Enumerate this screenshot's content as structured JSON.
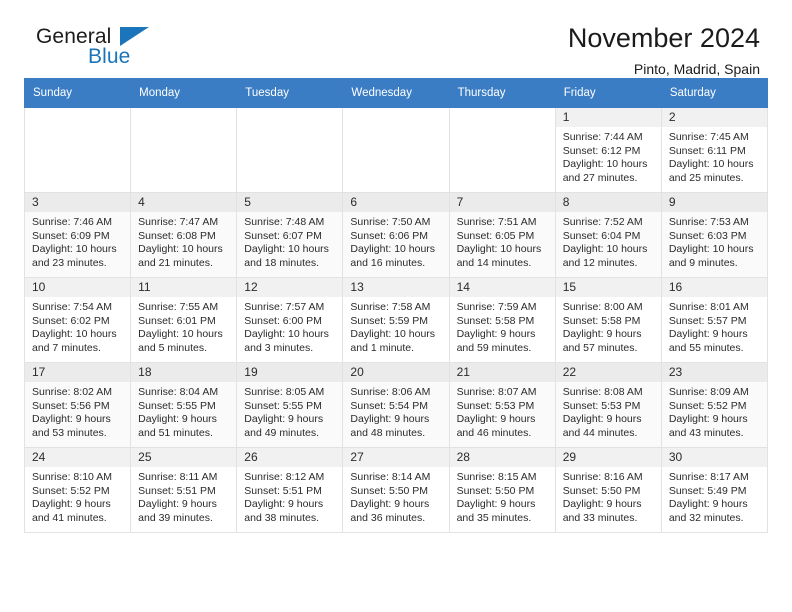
{
  "brand": {
    "name_part1": "General",
    "name_part2": "Blue",
    "logo_color": "#1b75bb"
  },
  "header": {
    "title": "November 2024",
    "location": "Pinto, Madrid, Spain"
  },
  "theme": {
    "header_row_bg": "#3b7dc4",
    "header_row_text": "#ffffff",
    "alt_row_bg": "#fafafa",
    "day_number_bg": "#f1f1f1"
  },
  "weekdays": [
    "Sunday",
    "Monday",
    "Tuesday",
    "Wednesday",
    "Thursday",
    "Friday",
    "Saturday"
  ],
  "labels": {
    "sunrise_prefix": "Sunrise:",
    "sunset_prefix": "Sunset:",
    "daylight_prefix": "Daylight:"
  },
  "weeks": [
    [
      {
        "empty": true
      },
      {
        "empty": true
      },
      {
        "empty": true
      },
      {
        "empty": true
      },
      {
        "empty": true
      },
      {
        "empty": false,
        "day": "1",
        "sunrise": "Sunrise: 7:44 AM",
        "sunset": "Sunset: 6:12 PM",
        "daylight_line1": "Daylight: 10 hours",
        "daylight_line2": "and 27 minutes."
      },
      {
        "empty": false,
        "day": "2",
        "sunrise": "Sunrise: 7:45 AM",
        "sunset": "Sunset: 6:11 PM",
        "daylight_line1": "Daylight: 10 hours",
        "daylight_line2": "and 25 minutes."
      }
    ],
    [
      {
        "empty": false,
        "day": "3",
        "sunrise": "Sunrise: 7:46 AM",
        "sunset": "Sunset: 6:09 PM",
        "daylight_line1": "Daylight: 10 hours",
        "daylight_line2": "and 23 minutes."
      },
      {
        "empty": false,
        "day": "4",
        "sunrise": "Sunrise: 7:47 AM",
        "sunset": "Sunset: 6:08 PM",
        "daylight_line1": "Daylight: 10 hours",
        "daylight_line2": "and 21 minutes."
      },
      {
        "empty": false,
        "day": "5",
        "sunrise": "Sunrise: 7:48 AM",
        "sunset": "Sunset: 6:07 PM",
        "daylight_line1": "Daylight: 10 hours",
        "daylight_line2": "and 18 minutes."
      },
      {
        "empty": false,
        "day": "6",
        "sunrise": "Sunrise: 7:50 AM",
        "sunset": "Sunset: 6:06 PM",
        "daylight_line1": "Daylight: 10 hours",
        "daylight_line2": "and 16 minutes."
      },
      {
        "empty": false,
        "day": "7",
        "sunrise": "Sunrise: 7:51 AM",
        "sunset": "Sunset: 6:05 PM",
        "daylight_line1": "Daylight: 10 hours",
        "daylight_line2": "and 14 minutes."
      },
      {
        "empty": false,
        "day": "8",
        "sunrise": "Sunrise: 7:52 AM",
        "sunset": "Sunset: 6:04 PM",
        "daylight_line1": "Daylight: 10 hours",
        "daylight_line2": "and 12 minutes."
      },
      {
        "empty": false,
        "day": "9",
        "sunrise": "Sunrise: 7:53 AM",
        "sunset": "Sunset: 6:03 PM",
        "daylight_line1": "Daylight: 10 hours",
        "daylight_line2": "and 9 minutes."
      }
    ],
    [
      {
        "empty": false,
        "day": "10",
        "sunrise": "Sunrise: 7:54 AM",
        "sunset": "Sunset: 6:02 PM",
        "daylight_line1": "Daylight: 10 hours",
        "daylight_line2": "and 7 minutes."
      },
      {
        "empty": false,
        "day": "11",
        "sunrise": "Sunrise: 7:55 AM",
        "sunset": "Sunset: 6:01 PM",
        "daylight_line1": "Daylight: 10 hours",
        "daylight_line2": "and 5 minutes."
      },
      {
        "empty": false,
        "day": "12",
        "sunrise": "Sunrise: 7:57 AM",
        "sunset": "Sunset: 6:00 PM",
        "daylight_line1": "Daylight: 10 hours",
        "daylight_line2": "and 3 minutes."
      },
      {
        "empty": false,
        "day": "13",
        "sunrise": "Sunrise: 7:58 AM",
        "sunset": "Sunset: 5:59 PM",
        "daylight_line1": "Daylight: 10 hours",
        "daylight_line2": "and 1 minute."
      },
      {
        "empty": false,
        "day": "14",
        "sunrise": "Sunrise: 7:59 AM",
        "sunset": "Sunset: 5:58 PM",
        "daylight_line1": "Daylight: 9 hours",
        "daylight_line2": "and 59 minutes."
      },
      {
        "empty": false,
        "day": "15",
        "sunrise": "Sunrise: 8:00 AM",
        "sunset": "Sunset: 5:58 PM",
        "daylight_line1": "Daylight: 9 hours",
        "daylight_line2": "and 57 minutes."
      },
      {
        "empty": false,
        "day": "16",
        "sunrise": "Sunrise: 8:01 AM",
        "sunset": "Sunset: 5:57 PM",
        "daylight_line1": "Daylight: 9 hours",
        "daylight_line2": "and 55 minutes."
      }
    ],
    [
      {
        "empty": false,
        "day": "17",
        "sunrise": "Sunrise: 8:02 AM",
        "sunset": "Sunset: 5:56 PM",
        "daylight_line1": "Daylight: 9 hours",
        "daylight_line2": "and 53 minutes."
      },
      {
        "empty": false,
        "day": "18",
        "sunrise": "Sunrise: 8:04 AM",
        "sunset": "Sunset: 5:55 PM",
        "daylight_line1": "Daylight: 9 hours",
        "daylight_line2": "and 51 minutes."
      },
      {
        "empty": false,
        "day": "19",
        "sunrise": "Sunrise: 8:05 AM",
        "sunset": "Sunset: 5:55 PM",
        "daylight_line1": "Daylight: 9 hours",
        "daylight_line2": "and 49 minutes."
      },
      {
        "empty": false,
        "day": "20",
        "sunrise": "Sunrise: 8:06 AM",
        "sunset": "Sunset: 5:54 PM",
        "daylight_line1": "Daylight: 9 hours",
        "daylight_line2": "and 48 minutes."
      },
      {
        "empty": false,
        "day": "21",
        "sunrise": "Sunrise: 8:07 AM",
        "sunset": "Sunset: 5:53 PM",
        "daylight_line1": "Daylight: 9 hours",
        "daylight_line2": "and 46 minutes."
      },
      {
        "empty": false,
        "day": "22",
        "sunrise": "Sunrise: 8:08 AM",
        "sunset": "Sunset: 5:53 PM",
        "daylight_line1": "Daylight: 9 hours",
        "daylight_line2": "and 44 minutes."
      },
      {
        "empty": false,
        "day": "23",
        "sunrise": "Sunrise: 8:09 AM",
        "sunset": "Sunset: 5:52 PM",
        "daylight_line1": "Daylight: 9 hours",
        "daylight_line2": "and 43 minutes."
      }
    ],
    [
      {
        "empty": false,
        "day": "24",
        "sunrise": "Sunrise: 8:10 AM",
        "sunset": "Sunset: 5:52 PM",
        "daylight_line1": "Daylight: 9 hours",
        "daylight_line2": "and 41 minutes."
      },
      {
        "empty": false,
        "day": "25",
        "sunrise": "Sunrise: 8:11 AM",
        "sunset": "Sunset: 5:51 PM",
        "daylight_line1": "Daylight: 9 hours",
        "daylight_line2": "and 39 minutes."
      },
      {
        "empty": false,
        "day": "26",
        "sunrise": "Sunrise: 8:12 AM",
        "sunset": "Sunset: 5:51 PM",
        "daylight_line1": "Daylight: 9 hours",
        "daylight_line2": "and 38 minutes."
      },
      {
        "empty": false,
        "day": "27",
        "sunrise": "Sunrise: 8:14 AM",
        "sunset": "Sunset: 5:50 PM",
        "daylight_line1": "Daylight: 9 hours",
        "daylight_line2": "and 36 minutes."
      },
      {
        "empty": false,
        "day": "28",
        "sunrise": "Sunrise: 8:15 AM",
        "sunset": "Sunset: 5:50 PM",
        "daylight_line1": "Daylight: 9 hours",
        "daylight_line2": "and 35 minutes."
      },
      {
        "empty": false,
        "day": "29",
        "sunrise": "Sunrise: 8:16 AM",
        "sunset": "Sunset: 5:50 PM",
        "daylight_line1": "Daylight: 9 hours",
        "daylight_line2": "and 33 minutes."
      },
      {
        "empty": false,
        "day": "30",
        "sunrise": "Sunrise: 8:17 AM",
        "sunset": "Sunset: 5:49 PM",
        "daylight_line1": "Daylight: 9 hours",
        "daylight_line2": "and 32 minutes."
      }
    ]
  ]
}
